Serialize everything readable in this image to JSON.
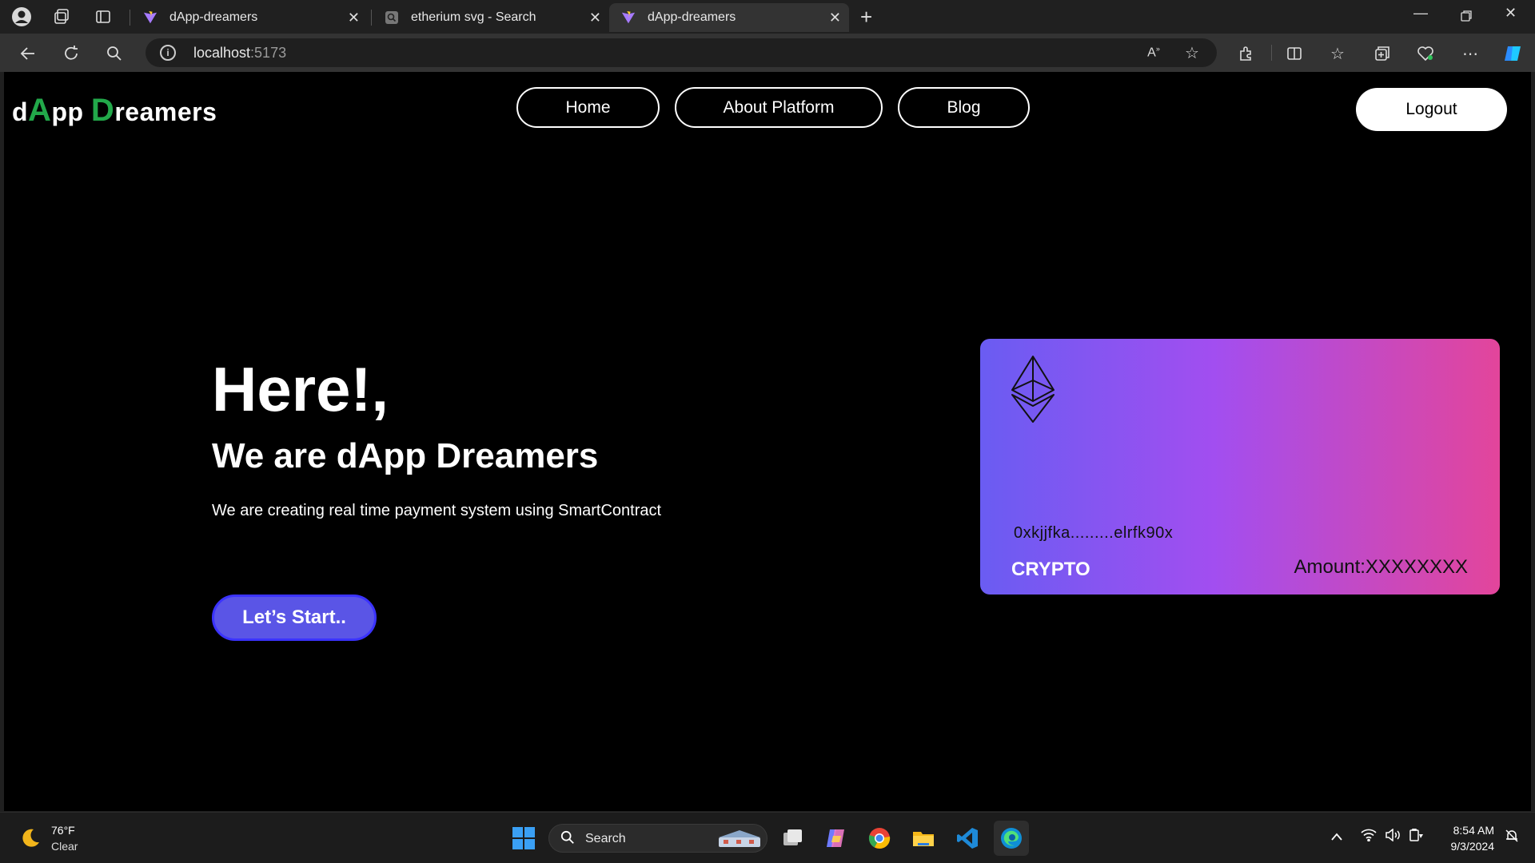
{
  "browser": {
    "tabs": [
      {
        "title": "dApp-dreamers",
        "active": false
      },
      {
        "title": "etherium svg - Search",
        "active": false
      },
      {
        "title": "dApp-dreamers",
        "active": true
      }
    ],
    "url_host": "localhost",
    "url_port": ":5173"
  },
  "site": {
    "logo": {
      "d": "d",
      "A": "A",
      "pp": "pp ",
      "D": "D",
      "reamers": "reamers"
    },
    "nav": [
      "Home",
      "About Platform",
      "Blog"
    ],
    "logout_label": "Logout"
  },
  "hero": {
    "heading": "Here!,",
    "subheading": "We are dApp Dreamers",
    "description": "We are creating real time payment system using SmartContract",
    "cta_label": "Let’s Start.."
  },
  "card": {
    "address": "0xkjjfka.........elrfk90x",
    "label": "CRYPTO",
    "amount": "Amount:XXXXXXXX"
  },
  "taskbar": {
    "weather_temp": "76°F",
    "weather_desc": "Clear",
    "search_label": "Search",
    "time": "8:54 AM",
    "date": "9/3/2024"
  },
  "colors": {
    "brand_green": "#22a84a",
    "cta": "#5a55e6",
    "card_gradient_start": "#6a5cf2",
    "card_gradient_end": "#e3459b"
  }
}
